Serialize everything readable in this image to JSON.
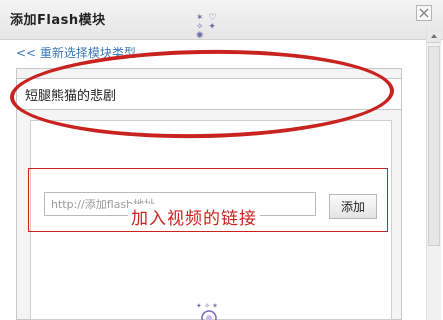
{
  "dialog": {
    "title": "添加Flash模块",
    "close_icon": "close-icon"
  },
  "back_link": {
    "label": "<< 重新选择模块类型"
  },
  "form": {
    "module_name_value": "短腿熊猫的悲剧",
    "url_placeholder": "http://添加flash地址",
    "url_value": "",
    "add_button_label": "添加"
  },
  "annotation": {
    "text": "加入视频的链接",
    "color": "#c8231f"
  },
  "decorations": {
    "top": "sparkle-icon",
    "bottom": "flower-icon"
  }
}
